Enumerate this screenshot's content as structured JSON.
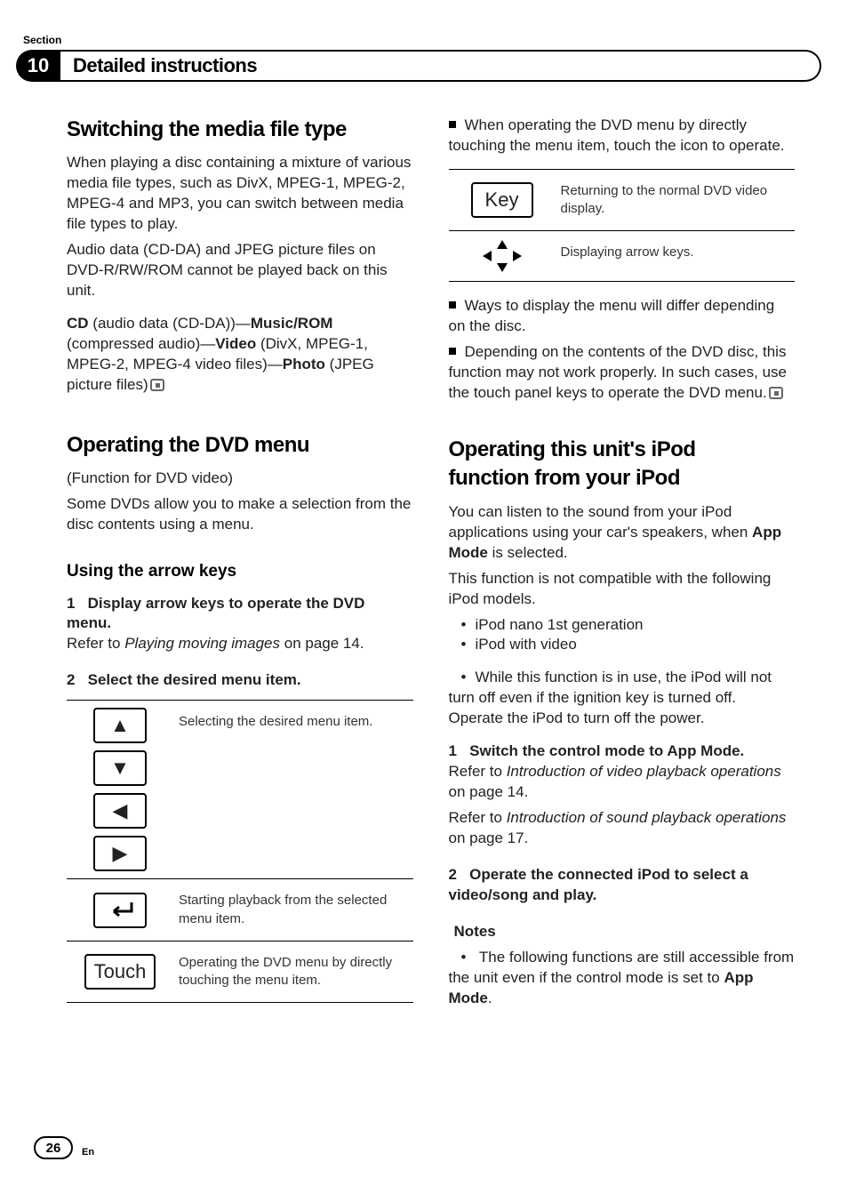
{
  "header": {
    "section_label": "Section",
    "section_num": "10",
    "title": "Detailed instructions"
  },
  "left": {
    "switching": {
      "title": "Switching the media file type",
      "p1": "When playing a disc containing a mixture of various media file types, such as DivX, MPEG-1, MPEG-2, MPEG-4 and MP3, you can switch between media file types to play.",
      "p2": "Audio data (CD-DA) and JPEG picture files on DVD-R/RW/ROM cannot be played back on this unit.",
      "chain_cd_bold": "CD",
      "chain_cd_rest": " (audio data (CD-DA))—",
      "chain_music_bold": "Music/ROM",
      "chain_music_rest": " (compressed audio)—",
      "chain_video_bold": "Video",
      "chain_video_rest": " (DivX, MPEG-1, MPEG-2, MPEG-4 video files)—",
      "chain_photo_bold": "Photo",
      "chain_photo_rest": " (JPEG picture files)"
    },
    "dvd_menu": {
      "title": "Operating the DVD menu",
      "sub1": "(Function for DVD video)",
      "sub2": "Some DVDs allow you to make a selection from the disc contents using a menu.",
      "arrow_keys_h": "Using the arrow keys",
      "step1_num": "1",
      "step1_title": "Display arrow keys to operate the DVD menu.",
      "step1_refer_pre": "Refer to ",
      "step1_refer_it": "Playing moving images",
      "step1_refer_post": " on page 14.",
      "step2_num": "2",
      "step2_title": "Select the desired menu item.",
      "tbl_row1_desc": "Selecting the desired menu item.",
      "tbl_row2_desc": "Starting playback from the selected menu item.",
      "tbl_row3_keylabel": "Touch",
      "tbl_row3_desc": "Operating the DVD menu by directly touching the menu item."
    }
  },
  "right": {
    "top_bullet": "When operating the DVD menu by directly touching the menu item, touch the icon to operate.",
    "tbl_row1_keylabel": "Key",
    "tbl_row1_desc": "Returning to the normal DVD video display.",
    "tbl_row2_desc": "Displaying arrow keys.",
    "bullet2": "Ways to display the menu will differ depending on the disc.",
    "bullet3": "Depending on the contents of the DVD disc, this function may not work properly. In such cases, use the touch panel keys to operate the DVD menu.",
    "ipod": {
      "title1": "Operating this unit's iPod",
      "title2": "function from your iPod",
      "p1_pre": "You can listen to the sound from your iPod applications using your car's speakers, when ",
      "p1_bold": "App Mode",
      "p1_post": " is selected.",
      "p2": "This function is not compatible with the following iPod models.",
      "li1": "iPod nano 1st generation",
      "li2": "iPod with video",
      "li3": "While this function is in use, the iPod will not turn off even if the ignition key is turned off. Operate the iPod to turn off the power.",
      "step1_num": "1",
      "step1_title": "Switch the control mode to App Mode.",
      "step1_ref1_pre": "Refer to ",
      "step1_ref1_it": "Introduction of video playback operations",
      "step1_ref1_post": " on page 14.",
      "step1_ref2_pre": "Refer to ",
      "step1_ref2_it": "Introduction of sound playback operations",
      "step1_ref2_post": " on page 17.",
      "step2_num": "2",
      "step2_title": "Operate the connected iPod to select a video/song and play.",
      "notes": "Notes",
      "note1_pre": "The following functions are still accessible from the unit even if the control mode is set to ",
      "note1_bold": "App Mode",
      "note1_post": "."
    }
  },
  "footer": {
    "page": "26",
    "lang": "En"
  }
}
